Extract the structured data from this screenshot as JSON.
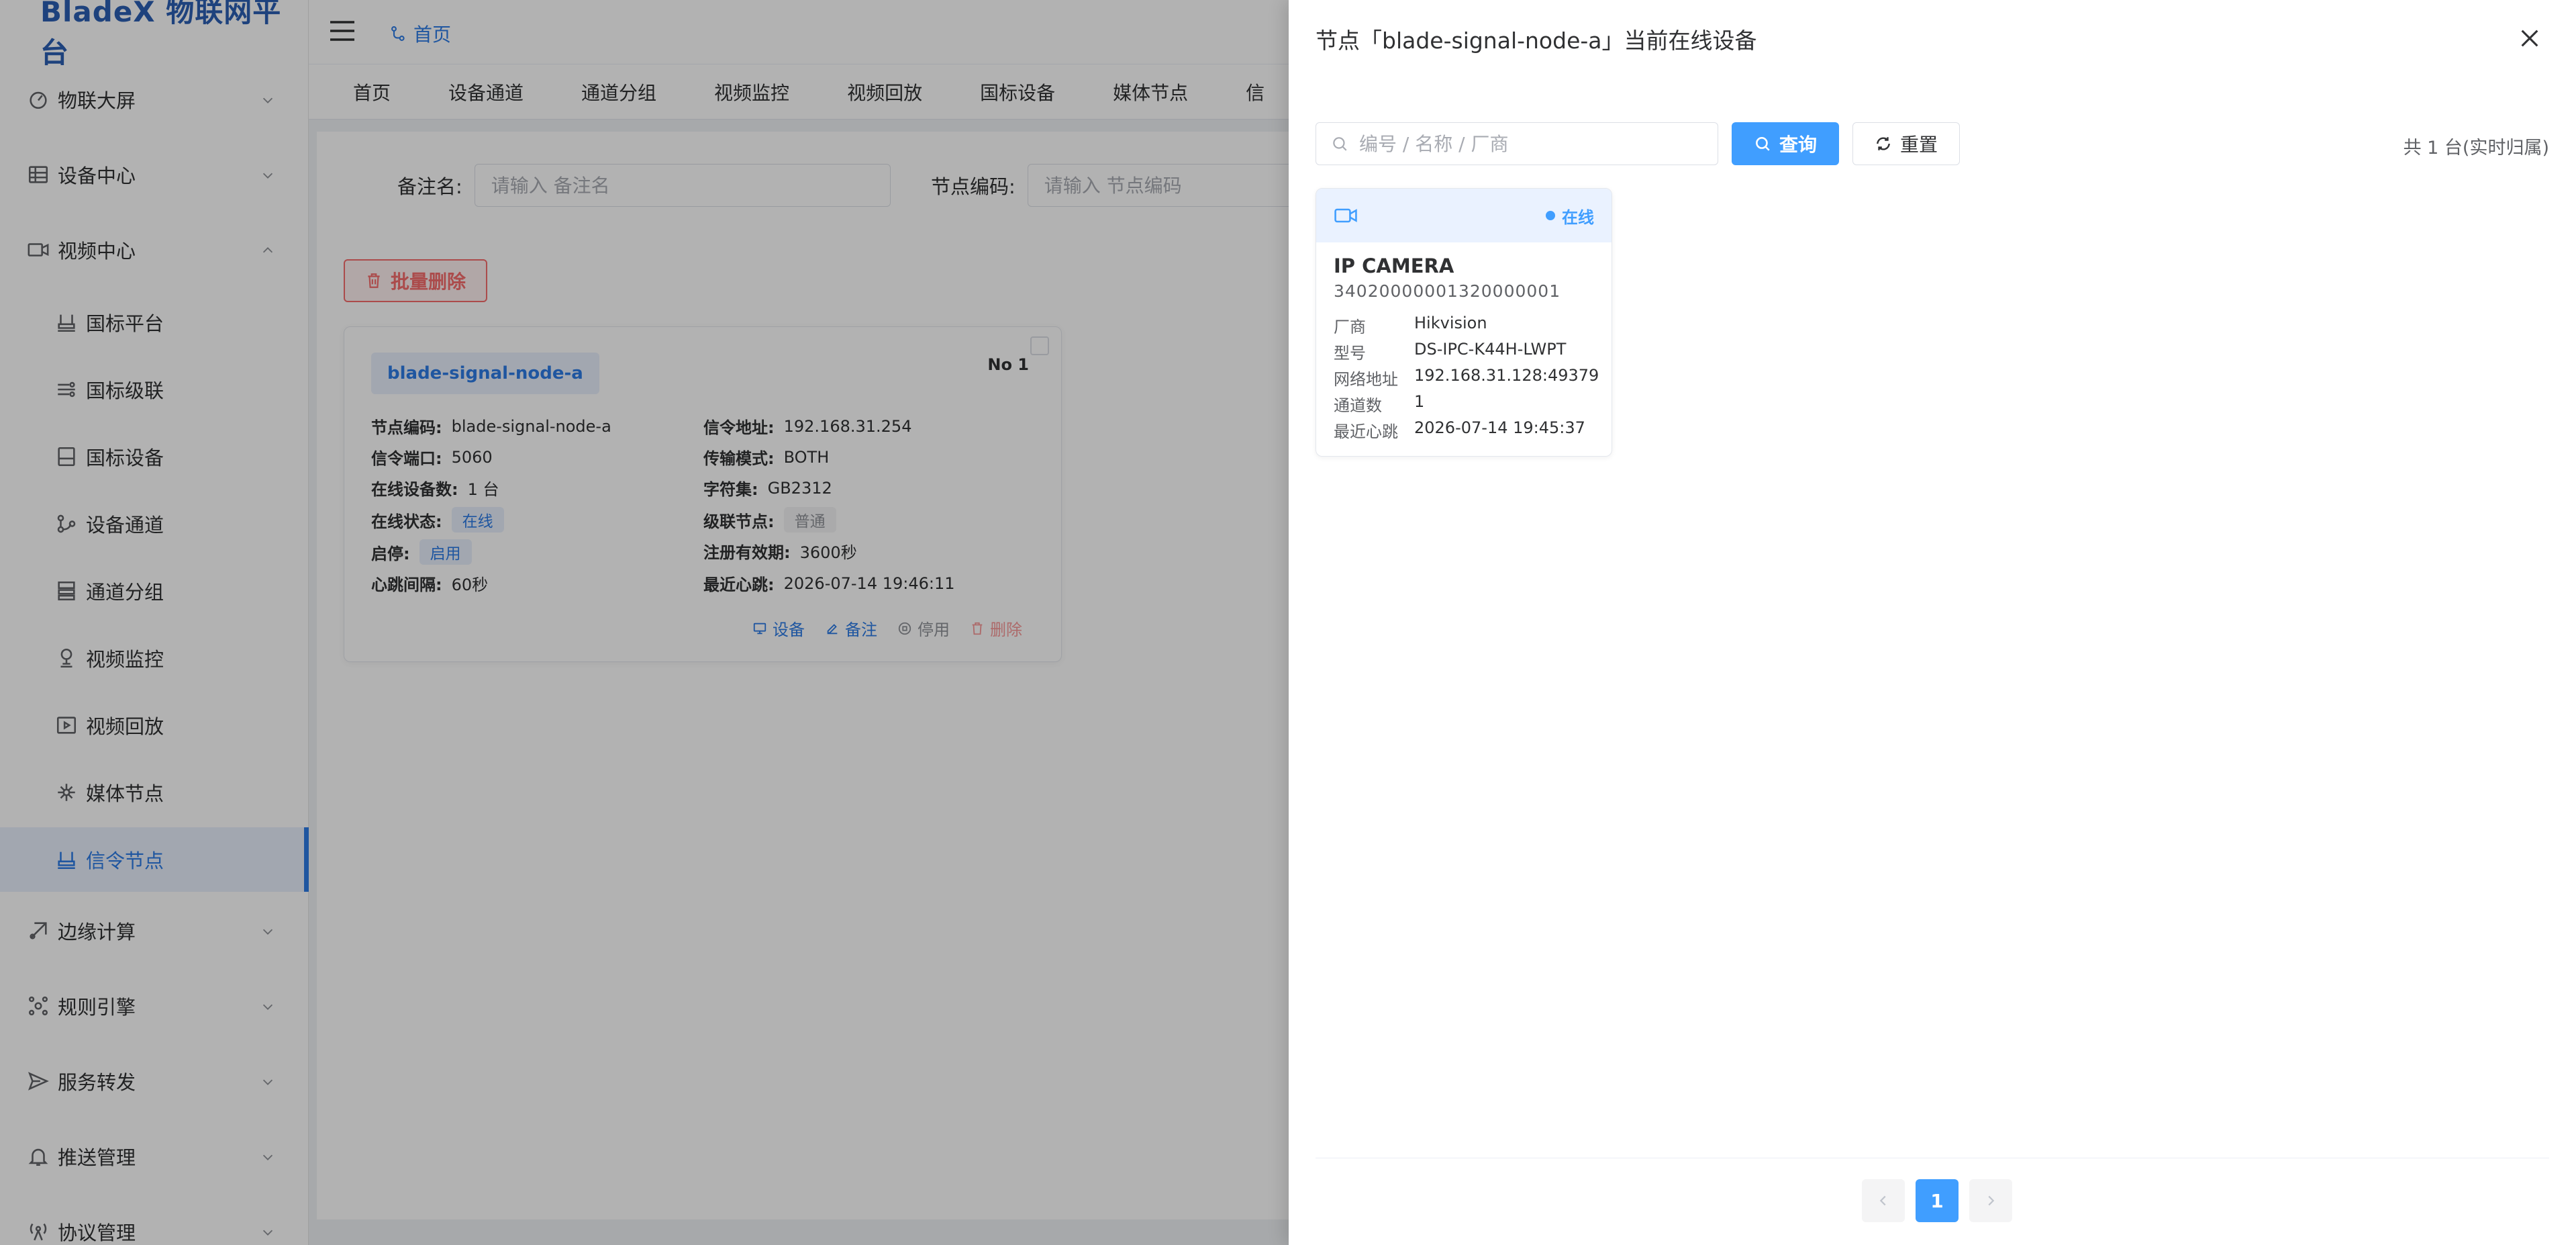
{
  "app": {
    "logo": "BladeX 物联网平台"
  },
  "sidebar": {
    "items": [
      {
        "label": "物联大屏"
      },
      {
        "label": "设备中心"
      },
      {
        "label": "视频中心"
      },
      {
        "label": "国标平台"
      },
      {
        "label": "国标级联"
      },
      {
        "label": "国标设备"
      },
      {
        "label": "设备通道"
      },
      {
        "label": "通道分组"
      },
      {
        "label": "视频监控"
      },
      {
        "label": "视频回放"
      },
      {
        "label": "媒体节点"
      },
      {
        "label": "信令节点"
      },
      {
        "label": "边缘计算"
      },
      {
        "label": "规则引擎"
      },
      {
        "label": "服务转发"
      },
      {
        "label": "推送管理"
      },
      {
        "label": "协议管理"
      }
    ]
  },
  "header": {
    "breadcrumb": "首页"
  },
  "tabs": [
    "首页",
    "设备通道",
    "通道分组",
    "视频监控",
    "视频回放",
    "国标设备",
    "媒体节点",
    "信"
  ],
  "search": {
    "remark_label": "备注名:",
    "remark_placeholder": "请输入 备注名",
    "code_label": "节点编码:",
    "code_placeholder": "请输入 节点编码"
  },
  "toolbar": {
    "batch_delete": "批量删除"
  },
  "node_card": {
    "tag": "blade-signal-node-a",
    "no": "No 1",
    "fields": {
      "code_k": "节点编码:",
      "code_v": "blade-signal-node-a",
      "addr_k": "信令地址:",
      "addr_v": "192.168.31.254",
      "port_k": "信令端口:",
      "port_v": "5060",
      "mode_k": "传输模式:",
      "mode_v": "BOTH",
      "online_k": "在线设备数:",
      "online_v": "1 台",
      "charset_k": "字符集:",
      "charset_v": "GB2312",
      "state_k": "在线状态:",
      "state_v": "在线",
      "cascade_k": "级联节点:",
      "cascade_v": "普通",
      "enable_k": "启停:",
      "enable_v": "启用",
      "expire_k": "注册有效期:",
      "expire_v": "3600秒",
      "beat_k": "心跳间隔:",
      "beat_v": "60秒",
      "last_k": "最近心跳:",
      "last_v": "2026-07-14 19:46:11"
    },
    "actions": {
      "device": "设备",
      "remark": "备注",
      "disable": "停用",
      "delete": "删除"
    }
  },
  "drawer": {
    "title": "节点「blade-signal-node-a」当前在线设备",
    "search_placeholder": "编号 / 名称 / 厂商",
    "query": "查询",
    "reset": "重置",
    "total": "共 1 台(实时归属)",
    "device": {
      "status": "在线",
      "name": "IP CAMERA",
      "id": "34020000001320000001",
      "vendor_k": "厂商",
      "vendor_v": "Hikvision",
      "model_k": "型号",
      "model_v": "DS-IPC-K44H-LWPT",
      "net_k": "网络地址",
      "net_v": "192.168.31.128:49379",
      "chan_k": "通道数",
      "chan_v": "1",
      "beat_k": "最近心跳",
      "beat_v": "2026-07-14 19:45:37"
    },
    "pagination": {
      "current": "1"
    }
  },
  "colors": {
    "primary": "#409eff",
    "brand": "#2b5fb3",
    "danger": "#f56c6c"
  }
}
